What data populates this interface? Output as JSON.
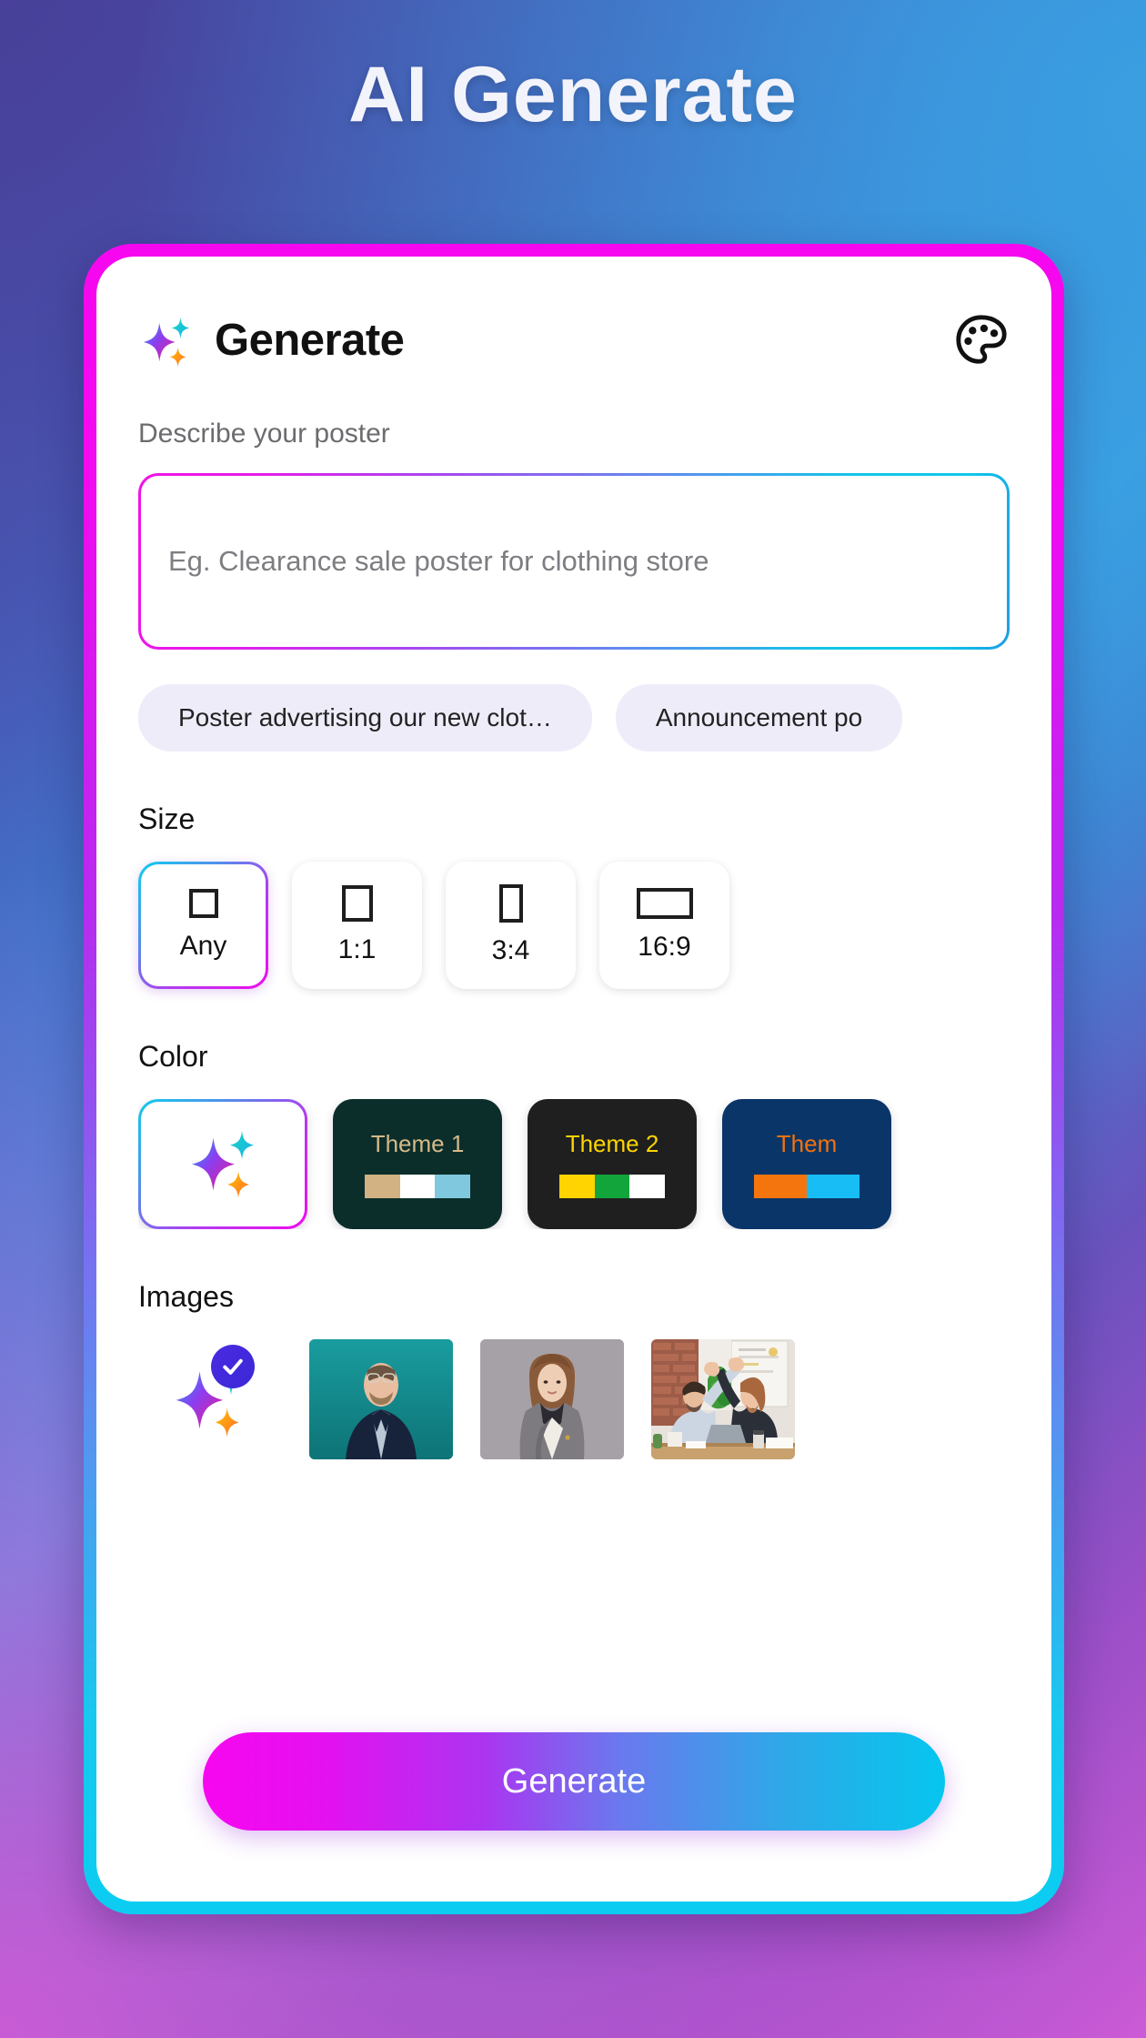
{
  "page": {
    "title": "AI Generate",
    "background_gradient": [
      "#4e4aa8",
      "#3aa0e2",
      "#cc5ad6"
    ]
  },
  "card": {
    "border_gradient": [
      "#f707ef",
      "#0bcdf1"
    ],
    "header": {
      "title": "Generate",
      "sparkle_icon": "ai-sparkle-icon",
      "palette_icon": "palette-icon"
    },
    "prompt": {
      "label": "Describe your poster",
      "placeholder": "Eg. Clearance sale poster for clothing store",
      "value": "",
      "border_gradient": [
        "#ef14e6",
        "#1d9de6"
      ]
    },
    "suggestions": [
      {
        "label": "Poster advertising our new clot…"
      },
      {
        "label": "Announcement po"
      }
    ],
    "size": {
      "title": "Size",
      "options": [
        {
          "label": "Any",
          "glyph": "square-small",
          "selected": true
        },
        {
          "label": "1:1",
          "glyph": "square",
          "selected": false
        },
        {
          "label": "3:4",
          "glyph": "portrait",
          "selected": false
        },
        {
          "label": "16:9",
          "glyph": "landscape",
          "selected": false
        }
      ]
    },
    "color": {
      "title": "Color",
      "options": [
        {
          "label": "",
          "type": "ai",
          "selected": true,
          "icon": "ai-sparkle-icon"
        },
        {
          "label": "Theme 1",
          "type": "theme",
          "selected": false,
          "bg": "#0b2e2a",
          "text_color": "#d5b989",
          "swatches": [
            "#d2b183",
            "#ffffff",
            "#7fc8dd"
          ]
        },
        {
          "label": "Theme 2",
          "type": "theme",
          "selected": false,
          "bg": "#1f1f1f",
          "text_color": "#ffd400",
          "swatches": [
            "#ffd400",
            "#12a53c",
            "#ffffff"
          ]
        },
        {
          "label": "Them",
          "type": "theme",
          "selected": false,
          "bg": "#0a3569",
          "text_color": "#f2720c",
          "swatches": [
            "#f4750d",
            "#18bdf5"
          ]
        }
      ]
    },
    "images": {
      "title": "Images",
      "options": [
        {
          "kind": "ai",
          "selected": true,
          "icon": "ai-sparkle-icon",
          "badge": "check-badge"
        },
        {
          "kind": "photo",
          "selected": false,
          "alt": "man-in-suit-teal-background"
        },
        {
          "kind": "photo",
          "selected": false,
          "alt": "woman-in-grey-suit"
        },
        {
          "kind": "photo",
          "selected": false,
          "alt": "office-high-five"
        }
      ]
    },
    "generate_button": {
      "label": "Generate",
      "gradient": [
        "#f707ef",
        "#05c6ee"
      ]
    }
  }
}
